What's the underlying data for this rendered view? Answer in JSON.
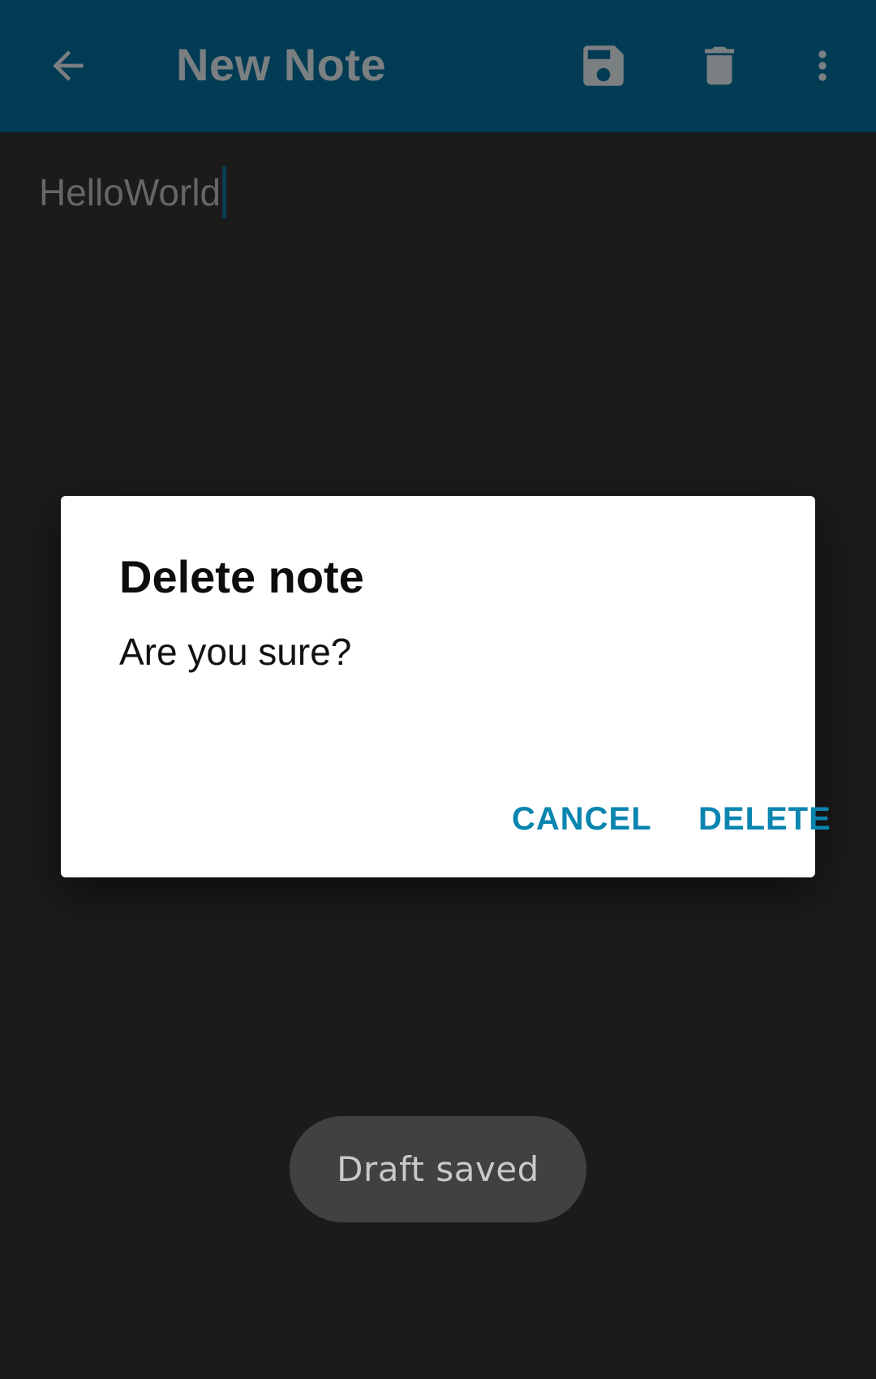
{
  "appbar": {
    "title": "New Note",
    "back_icon": "arrow-back-icon",
    "save_icon": "save-icon",
    "delete_icon": "trash-icon",
    "overflow_icon": "more-vert-icon",
    "color": "#023c54"
  },
  "editor": {
    "text": "HelloWorld"
  },
  "dialog": {
    "title": "Delete note",
    "message": "Are you sure?",
    "cancel_label": "CANCEL",
    "delete_label": "DELETE",
    "accent": "#0a85b0"
  },
  "toast": {
    "text": "Draft saved"
  }
}
